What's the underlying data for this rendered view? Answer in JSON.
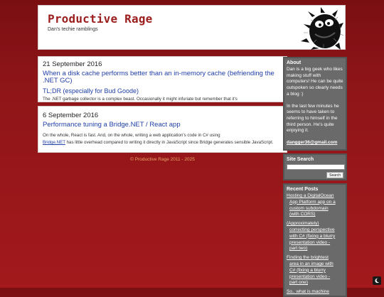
{
  "header": {
    "title": "Productive Rage",
    "tagline": "Dan's techie ramblings"
  },
  "posts": [
    {
      "date": "21 September 2016",
      "title": "When a disk cache performs better than an in-memory cache (befriending the .NET GC)",
      "subtitle": "TL;DR (especially for Bud Goode)",
      "excerpt": "The .NET garbage collector is a complex beast. Occasionally it might infuriate but remember that it's"
    },
    {
      "date": "6 September 2016",
      "title": "Performance tuning a Bridge.NET / React app",
      "excerpt_before": "On the whole, React is fast. And, on the whole, writing a web application's code in C# using",
      "excerpt_link": "Bridge.NET",
      "excerpt_after": "has little overhead compared to writing it directly in JavaScript since Bridge generates sensible JavaScript."
    }
  ],
  "footer": "© Productive Rage 2011 - 2025",
  "sidebar": {
    "about": {
      "heading": "About",
      "p1": "Dan is a big geek who likes making stuff with computers! He can be quite outspoken so clearly needs a blog :)",
      "p2": "In the last few minutes he seems to have taken to referring to himself in the third person. He's quite enjoying it.",
      "email": "dangger36@gmail.com"
    },
    "search": {
      "heading": "Site Search",
      "placeholder": "",
      "button_label": "Search"
    },
    "recent": {
      "heading": "Recent Posts",
      "items": [
        {
          "first": "Hosting a DigitalOcean",
          "rest": [
            "App Platform app on a",
            "custom subdomain",
            "(with CORS)"
          ]
        },
        {
          "first": "(Approximately)",
          "rest": [
            "correcting perspective",
            "with C# (fixing a blurry",
            "presentation video -",
            "part two)"
          ]
        },
        {
          "first": "Finding the brightest",
          "rest": [
            "area in an image with",
            "C# (fixing a blurry",
            "presentation video -",
            "part one)"
          ]
        },
        {
          "first": "So.. what is machine",
          "rest": []
        }
      ]
    }
  },
  "icons": {
    "dark_mode": "moon-icon",
    "logo": "fuzzy-monster-logo"
  },
  "colors": {
    "brand": "#9b1d1d",
    "link": "#2040a8",
    "background": "#8e1518",
    "sidebar": "#6a6a6a"
  }
}
